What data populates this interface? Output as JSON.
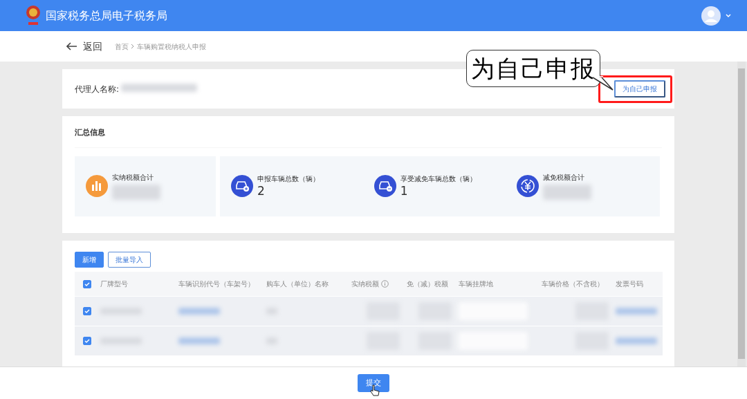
{
  "header": {
    "title": "国家税务总局电子税务局"
  },
  "nav": {
    "back": "返回",
    "breadcrumb": [
      {
        "label": "首页"
      },
      {
        "label": "车辆购置税纳税人申报"
      }
    ]
  },
  "agent": {
    "label": "代理人名称:",
    "value_redacted": true,
    "button": "为自己申报",
    "highlighted": true
  },
  "callout": {
    "text": "为自己申报"
  },
  "summary": {
    "title": "汇总信息",
    "panels": [
      {
        "stats": [
          {
            "label": "实纳税额合计",
            "kind": "chart",
            "color": "#f59a3c"
          }
        ]
      },
      {
        "stats": [
          {
            "label": "申报车辆总数（辆）",
            "kind": "car-plus",
            "color": "#3450d4",
            "value": "2"
          },
          {
            "label": "享受减免车辆总数（辆）",
            "kind": "car-minus",
            "color": "#3450d4",
            "value": "1"
          },
          {
            "label": "减免税额合计",
            "kind": "yen",
            "color": "#3450d4"
          }
        ]
      }
    ]
  },
  "actions": [
    {
      "label": "新增",
      "kind": "primary"
    },
    {
      "label": "批量导入",
      "kind": "outline"
    }
  ],
  "table": {
    "all_checked": true,
    "columns": [
      {
        "label": "厂牌型号",
        "kind": "plain"
      },
      {
        "label": "车辆识别代号（车架号）",
        "kind": "link"
      },
      {
        "label": "购车人（单位）名称",
        "kind": "plain"
      },
      {
        "label": "实纳税额",
        "kind": "amount",
        "info": true
      },
      {
        "label": "免（减）税额",
        "kind": "amount"
      },
      {
        "label": "车辆挂牌地",
        "kind": "select"
      },
      {
        "label": "车辆价格（不含税）",
        "kind": "amount"
      },
      {
        "label": "发票号码",
        "kind": "link"
      }
    ],
    "rows": [
      {
        "selected": true
      },
      {
        "selected": true
      }
    ]
  },
  "footer": {
    "submit": "提交"
  }
}
